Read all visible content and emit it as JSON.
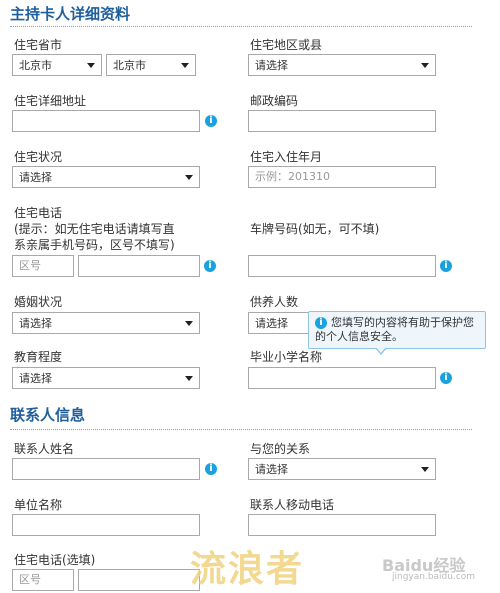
{
  "section1": {
    "title": "主持卡人详细资料",
    "province_label": "住宅省市",
    "province_value": "北京市",
    "city_value": "北京市",
    "district_label": "住宅地区或县",
    "district_value": "请选择",
    "address_label": "住宅详细地址",
    "postcode_label": "邮政编码",
    "housing_label": "住宅状况",
    "housing_value": "请选择",
    "move_in_label": "住宅入住年月",
    "move_in_placeholder": "示例：201310",
    "home_phone_label": "住宅电话",
    "home_phone_hint1": "(提示：如无住宅电话请填写直",
    "home_phone_hint2": "系亲属手机号码，区号不填写)",
    "area_code_placeholder": "区号",
    "plate_label": "车牌号码(如无，可不填)",
    "marital_label": "婚姻状况",
    "marital_value": "请选择",
    "dependents_label": "供养人数",
    "dependents_value": "请选择",
    "tooltip_line1": "您填写的内容将有助于保护您",
    "tooltip_line2": "的个人信息安全。",
    "education_label": "教育程度",
    "education_value": "请选择",
    "school_label": "毕业小学名称"
  },
  "section2": {
    "title": "联系人信息",
    "contact_name_label": "联系人姓名",
    "relation_label": "与您的关系",
    "relation_value": "请选择",
    "company_label": "单位名称",
    "contact_mobile_label": "联系人移动电话",
    "home_phone_label": "住宅电话(选填)",
    "area_code_placeholder": "区号"
  },
  "icons": {
    "info": "i"
  },
  "watermark": {
    "text": "流浪者",
    "brand": "Baidu经验",
    "url": "jingyan.baidu.com"
  }
}
